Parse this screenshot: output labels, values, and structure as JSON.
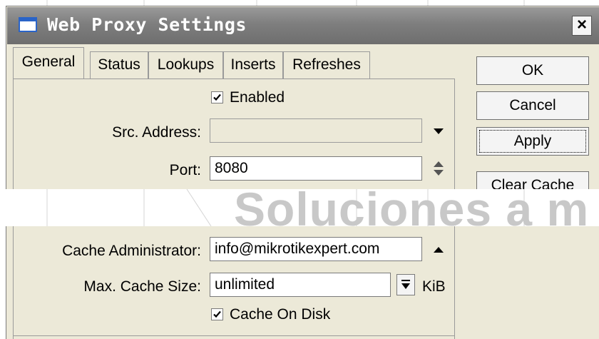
{
  "window": {
    "title": "Web Proxy Settings",
    "close_label": "×"
  },
  "tabs": [
    {
      "label": "General",
      "active": true
    },
    {
      "label": "Status",
      "active": false
    },
    {
      "label": "Lookups",
      "active": false
    },
    {
      "label": "Inserts",
      "active": false
    },
    {
      "label": "Refreshes",
      "active": false
    }
  ],
  "form": {
    "enabled": {
      "label": "Enabled",
      "checked": true
    },
    "src_address": {
      "label": "Src. Address:",
      "value": ""
    },
    "port": {
      "label": "Port:",
      "value": "8080"
    },
    "cache_admin": {
      "label": "Cache Administrator:",
      "value": "info@mikrotikexpert.com"
    },
    "max_cache": {
      "label": "Max. Cache Size:",
      "value": "unlimited",
      "unit": "KiB"
    },
    "cache_on_disk": {
      "label": "Cache On Disk",
      "checked": true
    }
  },
  "buttons": {
    "ok": "OK",
    "cancel": "Cancel",
    "apply": "Apply",
    "clear_cache": "Clear Cache"
  },
  "watermark": "Soluciones a m",
  "icons": {
    "check": "checkmark-icon",
    "dropdown": "dropdown-arrow-icon",
    "spinner": "spinner-updown-icon",
    "collapse": "collapse-up-icon",
    "unit_dropdown": "unit-dropdown-icon",
    "window": "window-icon"
  },
  "colors": {
    "titlebar": "#7e7e7e",
    "panel": "#ece9d8",
    "icon_blue": "#2a64c8"
  }
}
